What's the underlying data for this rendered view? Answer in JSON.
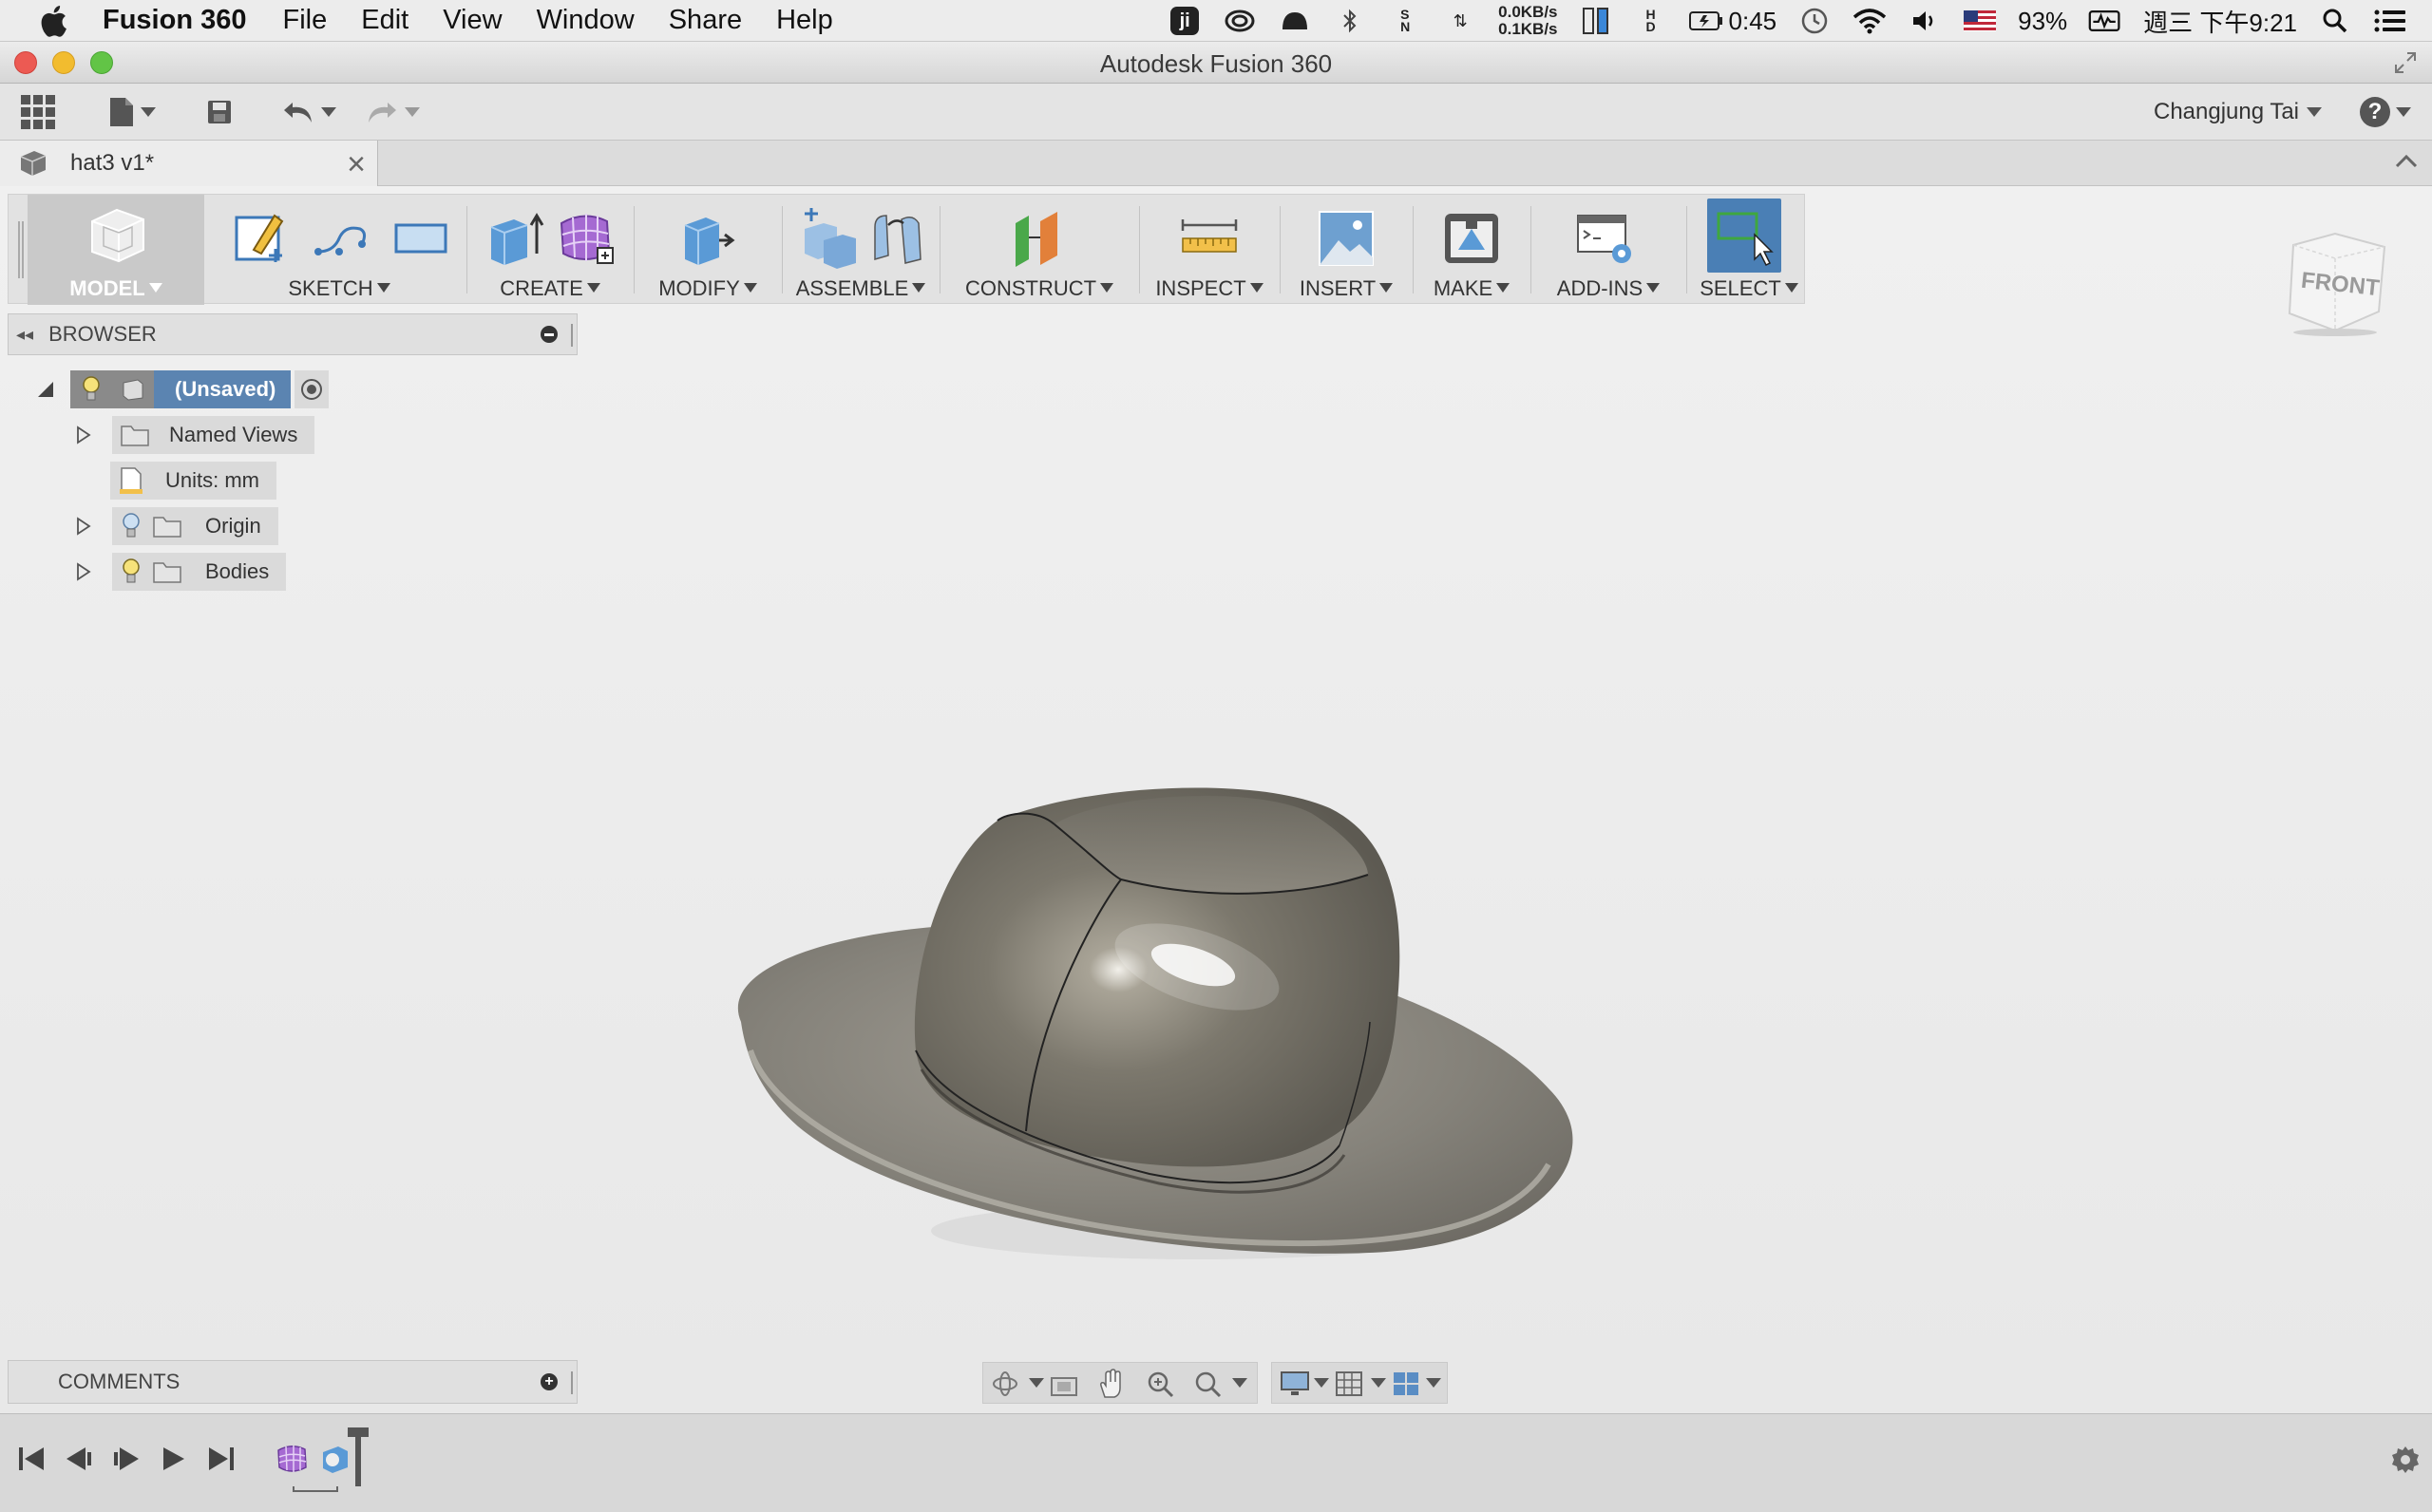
{
  "menubar": {
    "app_name": "Fusion 360",
    "menus": [
      "File",
      "Edit",
      "View",
      "Window",
      "Share",
      "Help"
    ],
    "net_up": "0.0KB/s",
    "net_down": "0.1KB/s",
    "battery_time": "0:45",
    "battery_percent": "93%",
    "datetime": "週三 下午9:21"
  },
  "window": {
    "title": "Autodesk Fusion 360"
  },
  "app_toolbar": {
    "user_name": "Changjung Tai",
    "help_icon": "?"
  },
  "document_tab": {
    "label": "hat3 v1*",
    "close": "×"
  },
  "ribbon": {
    "workspace_label": "MODEL",
    "groups": [
      {
        "label": "SKETCH"
      },
      {
        "label": "CREATE"
      },
      {
        "label": "MODIFY"
      },
      {
        "label": "ASSEMBLE"
      },
      {
        "label": "CONSTRUCT"
      },
      {
        "label": "INSPECT"
      },
      {
        "label": "INSERT"
      },
      {
        "label": "MAKE"
      },
      {
        "label": "ADD-INS"
      },
      {
        "label": "SELECT"
      }
    ]
  },
  "browser": {
    "title": "BROWSER",
    "root": "(Unsaved)",
    "items": [
      {
        "label": "Named Views"
      },
      {
        "label": "Units: mm"
      },
      {
        "label": "Origin"
      },
      {
        "label": "Bodies"
      }
    ]
  },
  "comments": {
    "title": "COMMENTS"
  },
  "viewcube": {
    "face": "FRONT"
  },
  "colors": {
    "selected_highlight": "#5b84b1",
    "select_button": "#4a7fb5",
    "body_surface": "#8a8780"
  }
}
